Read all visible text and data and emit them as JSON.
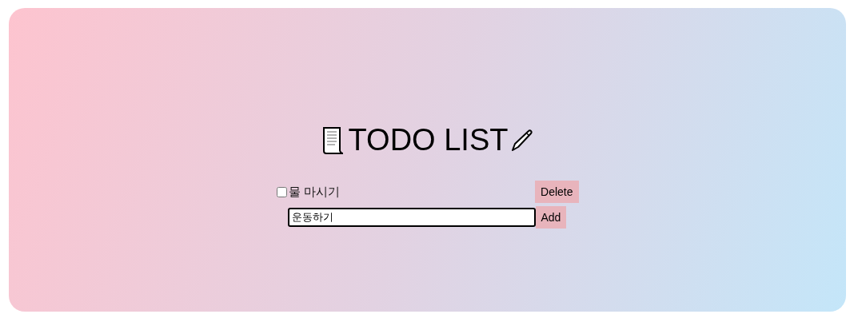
{
  "title": "TODO LIST",
  "todos": [
    {
      "text": "물 마시기",
      "checked": false,
      "action": "Delete"
    }
  ],
  "new_todo": {
    "value": "운동하기",
    "button": "Add"
  }
}
